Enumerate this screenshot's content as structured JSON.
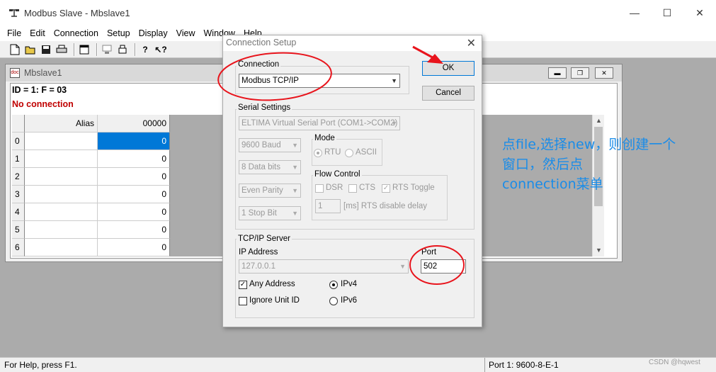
{
  "window": {
    "title": "Modbus Slave - Mbslave1",
    "min": "—",
    "max": "☐",
    "close": "✕"
  },
  "menu": [
    "File",
    "Edit",
    "Connection",
    "Setup",
    "Display",
    "View",
    "Window",
    "Help"
  ],
  "toolbar": {
    "icons": [
      "new-icon",
      "open-icon",
      "save-icon",
      "print-icon",
      "window-icon",
      "monitor-icon",
      "printer-icon",
      "help-icon",
      "context-help-icon"
    ]
  },
  "child": {
    "title": "Mbslave1",
    "info_line": "ID = 1: F = 03",
    "status_line": "No connection",
    "columns": [
      "Alias",
      "00000"
    ],
    "rows": [
      {
        "idx": "0",
        "alias": "",
        "value": "0"
      },
      {
        "idx": "1",
        "alias": "",
        "value": "0"
      },
      {
        "idx": "2",
        "alias": "",
        "value": "0"
      },
      {
        "idx": "3",
        "alias": "",
        "value": "0"
      },
      {
        "idx": "4",
        "alias": "",
        "value": "0"
      },
      {
        "idx": "5",
        "alias": "",
        "value": "0"
      },
      {
        "idx": "6",
        "alias": "",
        "value": "0"
      }
    ]
  },
  "dialog": {
    "title": "Connection Setup",
    "close": "✕",
    "connection_group": "Connection",
    "connection_value": "Modbus TCP/IP",
    "ok": "OK",
    "cancel": "Cancel",
    "serial_group": "Serial Settings",
    "serial_port": "ELTIMA Virtual Serial Port (COM1->COM2)",
    "baud": "9600 Baud",
    "data_bits": "8 Data bits",
    "parity": "Even Parity",
    "stop_bits": "1 Stop Bit",
    "mode_group": "Mode",
    "mode_rtu": "RTU",
    "mode_ascii": "ASCII",
    "flow_group": "Flow Control",
    "dsr": "DSR",
    "cts": "CTS",
    "rts_toggle": "RTS Toggle",
    "rts_delay": "1",
    "rts_delay_label": "[ms] RTS disable delay",
    "tcp_group": "TCP/IP Server",
    "ip_label": "IP Address",
    "ip_value": "127.0.0.1",
    "port_label": "Port",
    "port_value": "502",
    "any_address": "Any Address",
    "ignore_unit_id": "Ignore Unit ID",
    "ipv4": "IPv4",
    "ipv6": "IPv6"
  },
  "annotation": {
    "line1": "点file,选择new，则创建一个",
    "line2": "窗口，然后点",
    "line3": "connection菜单",
    "color": "#1a8ce8",
    "circle_color": "#e8141c"
  },
  "status": {
    "help": "For Help, press F1.",
    "port": "Port 1: 9600-8-E-1",
    "watermark": "CSDN @hqwest"
  }
}
